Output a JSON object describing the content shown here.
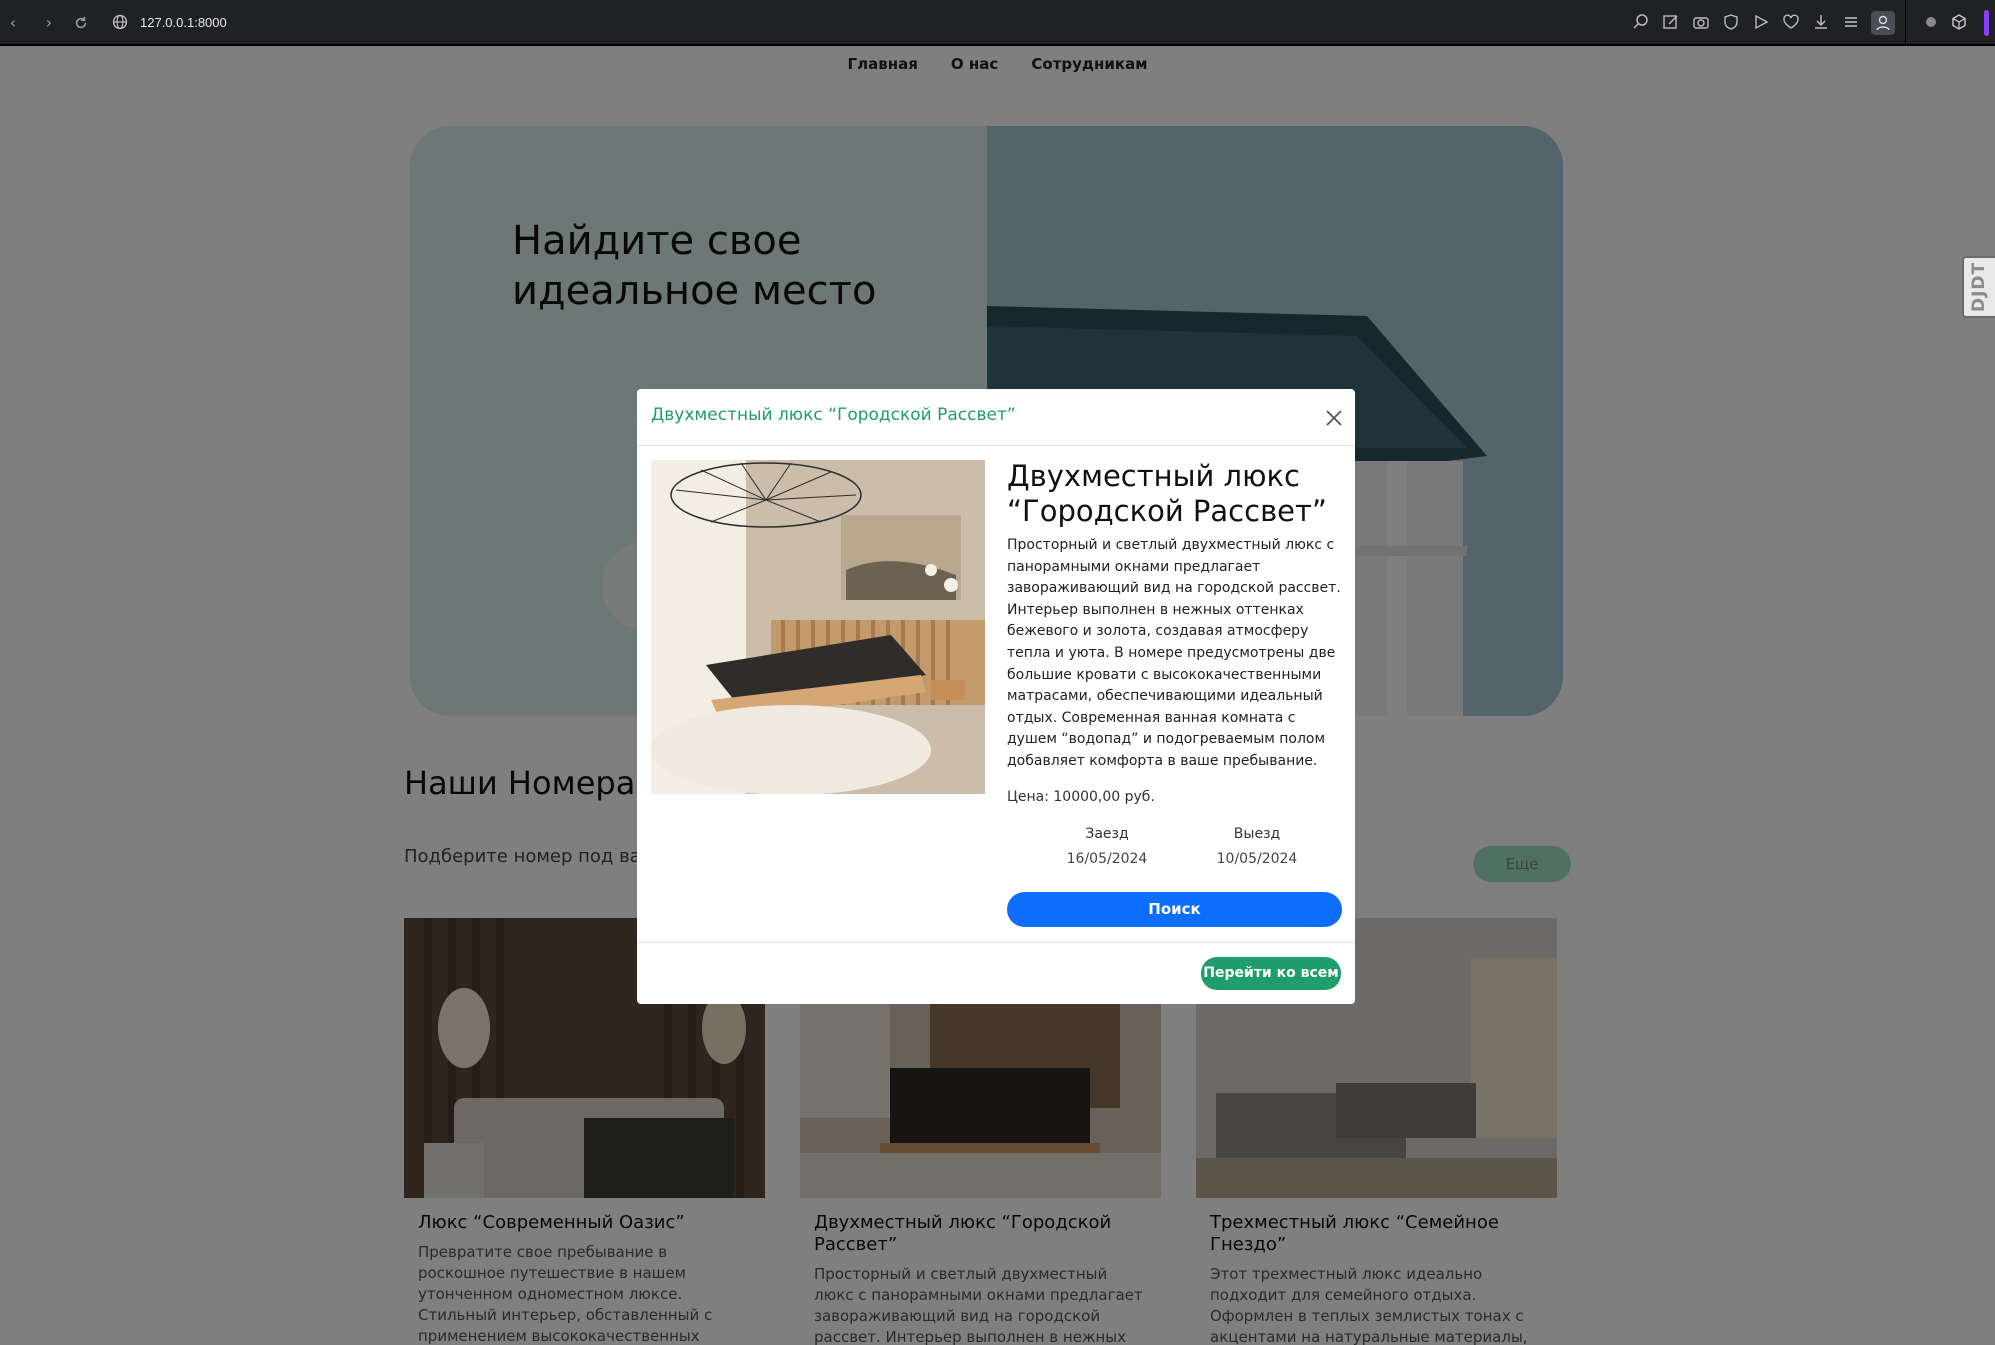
{
  "browser": {
    "url": "127.0.0.1:8000",
    "back_icon": "chevron-left-icon",
    "forward_icon": "chevron-right-icon",
    "reload_icon": "reload-icon"
  },
  "site_nav": {
    "items": [
      "Главная",
      "О нас",
      "Сотрудникам"
    ]
  },
  "hero": {
    "title": "Найдите свое идеальное место"
  },
  "rooms_section": {
    "title": "Наши Номера",
    "subtitle": "Подберите номер под ваш",
    "more_label": "Еще"
  },
  "cards": [
    {
      "title": "Люкс “Современный Оазис”",
      "text": "Превратите свое пребывание в роскошное путешествие в нашем утонченном одноместном люксе. Стильный интерьер, обставленный с применением высококачественных материалов, и просторная кровать King Size обеспечат"
    },
    {
      "title": "Двухместный люкс “Городской Рассвет”",
      "text": "Просторный и светлый двухместный люкс с панорамными окнами предлагает завораживающий вид на городской рассвет. Интерьер выполнен в нежных оттенках"
    },
    {
      "title": "Трехместный люкс “Семейное Гнездо”",
      "text": "Этот трехместный люкс идеально подходит для семейного отдыха. Оформлен в теплых землистых тонах с акцентами на натуральные материалы, номер создает ощущение"
    }
  ],
  "side_widget": {
    "label": "DJDT"
  },
  "modal": {
    "header_title": "Двухместный люкс “Городской Рассвет”",
    "room_title": "Двухместный люкс “Городской Рассвет”",
    "description": "Просторный и светлый двухместный люкс с панорамными окнами предлагает завораживающий вид на городской рассвет. Интерьер выполнен в нежных оттенках бежевого и золота, создавая атмосферу тепла и уюта. В номере предусмотрены две большие кровати с высококачественными матрасами, обеспечивающими идеальный отдых. Современная ванная комната с душем “водопад” и подогреваемым полом добавляет комфорта в ваше пребывание.",
    "price": "Цена: 10000,00 руб.",
    "checkin_label": "Заезд",
    "checkin_value": "16/05/2024",
    "checkout_label": "Выезд",
    "checkout_value": "10/05/2024",
    "search_label": "Поиск",
    "goto_all_label": "Перейти ко всем"
  },
  "colors": {
    "accent_green": "#1f9d6a",
    "primary_blue": "#0d6efd",
    "browser_bg": "#1f2125"
  }
}
